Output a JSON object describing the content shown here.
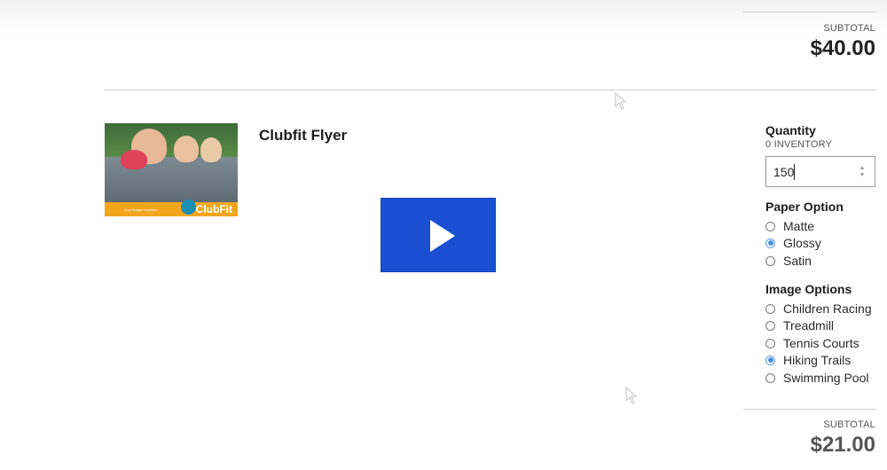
{
  "top_section": {
    "subtotal_label": "SUBTOTAL",
    "subtotal_value": "$40.00"
  },
  "product": {
    "title": "Clubfit Flyer",
    "thumbnail": {
      "brand_text": "ClubFit",
      "banner_text": "Your Image Headline",
      "accent_color": "#f3a51c"
    },
    "video_play_label": "Play video",
    "play_button_color": "#1a4fd1"
  },
  "options": {
    "quantity": {
      "label": "Quantity",
      "inventory": "0 INVENTORY",
      "value": "150"
    },
    "paper_option": {
      "label": "Paper Option",
      "choices": [
        "Matte",
        "Glossy",
        "Satin"
      ],
      "selected": "Glossy"
    },
    "image_options": {
      "label": "Image Options",
      "choices": [
        "Children Racing",
        "Treadmill",
        "Tennis Courts",
        "Hiking Trails",
        "Swimming Pool"
      ],
      "selected": "Hiking Trails"
    }
  },
  "bottom_section": {
    "subtotal_label": "SUBTOTAL",
    "subtotal_value": "$21.00"
  }
}
